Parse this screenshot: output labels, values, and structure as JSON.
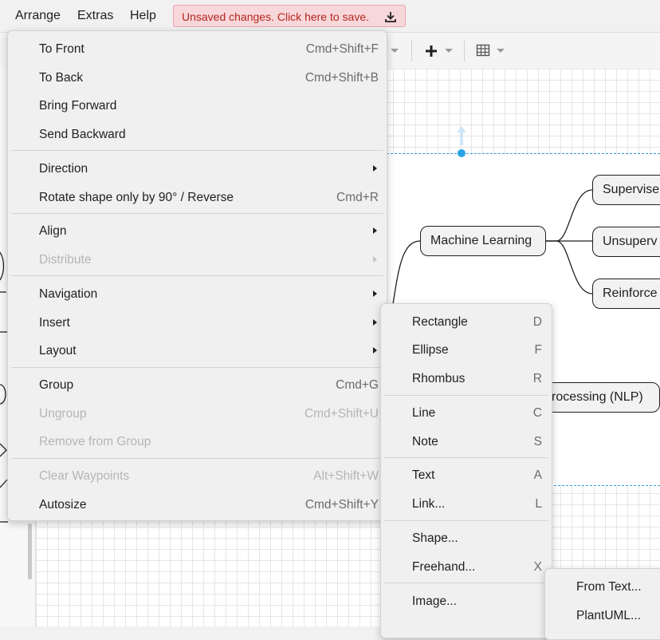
{
  "menubar": {
    "items": [
      "Arrange",
      "Extras",
      "Help"
    ],
    "unsaved": "Unsaved changes. Click here to save."
  },
  "diagram": {
    "nodes": [
      "Machine Learning",
      "Supervise",
      "Unsuperv",
      "Reinforce",
      "rocessing (NLP)"
    ]
  },
  "arrange_menu": {
    "items": [
      {
        "label": "To Front",
        "shortcut": "Cmd+Shift+F"
      },
      {
        "label": "To Back",
        "shortcut": "Cmd+Shift+B"
      },
      {
        "label": "Bring Forward"
      },
      {
        "label": "Send Backward"
      },
      {
        "label": "Direction"
      },
      {
        "label": "Rotate shape only by 90° / Reverse",
        "shortcut": "Cmd+R"
      },
      {
        "label": "Align"
      },
      {
        "label": "Distribute"
      },
      {
        "label": "Navigation"
      },
      {
        "label": "Insert"
      },
      {
        "label": "Layout"
      },
      {
        "label": "Group",
        "shortcut": "Cmd+G"
      },
      {
        "label": "Ungroup",
        "shortcut": "Cmd+Shift+U"
      },
      {
        "label": "Remove from Group"
      },
      {
        "label": "Clear Waypoints",
        "shortcut": "Alt+Shift+W"
      },
      {
        "label": "Autosize",
        "shortcut": "Cmd+Shift+Y"
      }
    ]
  },
  "insert_menu": {
    "items": [
      {
        "label": "Rectangle",
        "shortcut": "D"
      },
      {
        "label": "Ellipse",
        "shortcut": "F"
      },
      {
        "label": "Rhombus",
        "shortcut": "R"
      },
      {
        "label": "Line",
        "shortcut": "C"
      },
      {
        "label": "Note",
        "shortcut": "S"
      },
      {
        "label": "Text",
        "shortcut": "A"
      },
      {
        "label": "Link...",
        "shortcut": "L"
      },
      {
        "label": "Shape..."
      },
      {
        "label": "Freehand...",
        "shortcut": "X"
      },
      {
        "label": "Image..."
      }
    ]
  },
  "advanced_menu": {
    "items": [
      "From Text...",
      "PlantUML..."
    ]
  }
}
